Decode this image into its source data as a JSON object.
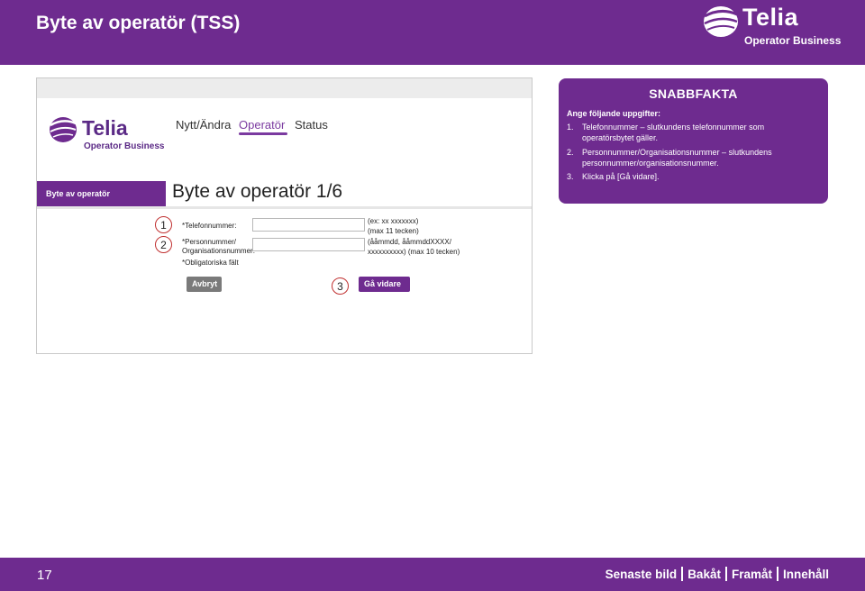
{
  "header": {
    "title": "Byte av operatör (TSS)"
  },
  "brand": {
    "name": "Telia",
    "sub": "Operator Business",
    "icon": "telia-pebble-icon"
  },
  "screenshot": {
    "logo": {
      "name": "Telia",
      "sub": "Operator Business"
    },
    "nav": [
      "Nytt/Ändra",
      "Operatör",
      "Status"
    ],
    "side_tab": "Byte av operatör",
    "form_title": "Byte av operatör 1/6",
    "fields": [
      {
        "label": "*Telefonnummer:",
        "hint1": "(ex: xx xxxxxxx)",
        "hint2": "(max 11 tecken)",
        "value": ""
      },
      {
        "label1": "*Personnummer/",
        "label2": "Organisationsnummer:",
        "hint1": "(ååmmdd, ååmmddXXXX/",
        "hint2": "xxxxxxxxxx) (max 10 tecken)",
        "value": ""
      }
    ],
    "required_note": "*Obligatoriska fält",
    "cancel_label": "Avbryt",
    "next_label": "Gå vidare",
    "markers": [
      "1",
      "2",
      "3"
    ]
  },
  "facts": {
    "heading": "SNABBFAKTA",
    "intro": "Ange följande uppgifter:",
    "items": [
      {
        "num": "1.",
        "text": "Telefonnummer – slutkundens telefonnummer som operatörsbytet gäller."
      },
      {
        "num": "2.",
        "text": "Personnummer/Organisationsnummer – slutkundens personnummer/organisationsnummer."
      },
      {
        "num": "3.",
        "text": "Klicka på [Gå vidare]."
      }
    ]
  },
  "footer": {
    "page": "17",
    "links": [
      "Senaste bild",
      "Bakåt",
      "Framåt",
      "Innehåll"
    ]
  },
  "colors": {
    "brand_purple": "#6e2b8f",
    "accent_purple": "#7b3aa0",
    "marker_red": "#c03030"
  }
}
